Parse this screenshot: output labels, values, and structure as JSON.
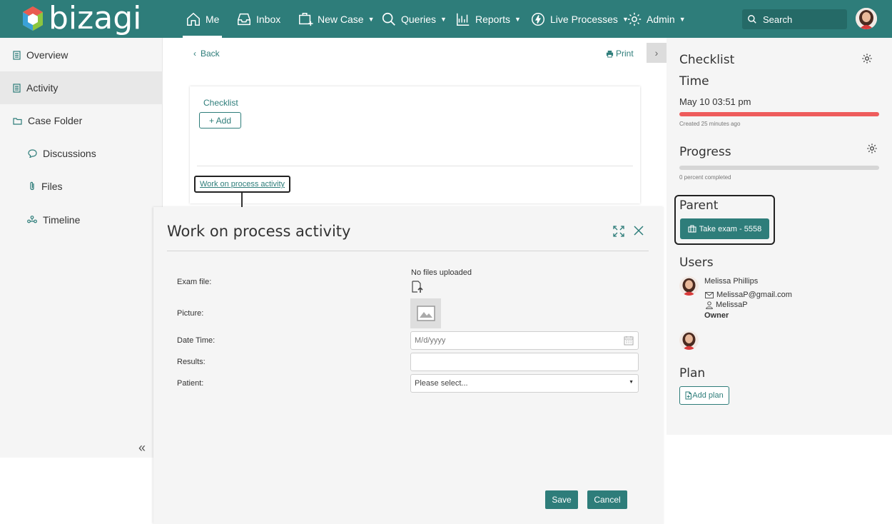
{
  "app": {
    "brand": "bizagi"
  },
  "nav": {
    "items": [
      {
        "label": "Me",
        "icon": "home-icon",
        "active": true
      },
      {
        "label": "Inbox",
        "icon": "inbox-icon"
      },
      {
        "label": "New Case",
        "icon": "new-case-icon",
        "dropdown": true
      },
      {
        "label": "Queries",
        "icon": "search-icon",
        "dropdown": true
      },
      {
        "label": "Reports",
        "icon": "chart-icon",
        "dropdown": true
      },
      {
        "label": "Live Processes",
        "icon": "lightning-icon",
        "dropdown": true
      },
      {
        "label": "Admin",
        "icon": "gear-icon",
        "dropdown": true
      }
    ],
    "search_placeholder": "Search"
  },
  "sidebar": {
    "items": [
      {
        "label": "Overview",
        "icon": "document-icon"
      },
      {
        "label": "Activity",
        "icon": "document-icon",
        "active": true
      },
      {
        "label": "Case Folder",
        "icon": "folder-icon"
      },
      {
        "label": "Discussions",
        "icon": "chat-icon"
      },
      {
        "label": "Files",
        "icon": "paperclip-icon"
      },
      {
        "label": "Timeline",
        "icon": "timeline-icon"
      }
    ]
  },
  "main": {
    "back_label": "Back",
    "print_label": "Print",
    "checklist_title": "Checklist",
    "add_label": "+ Add",
    "activity_link": "Work on process activity"
  },
  "modal": {
    "title": "Work on process activity",
    "fields": {
      "exam_file_label": "Exam file:",
      "no_files": "No files uploaded",
      "picture_label": "Picture:",
      "date_time_label": "Date Time:",
      "date_placeholder": "M/d/yyyy",
      "results_label": "Results:",
      "results_value": "",
      "patient_label": "Patient:",
      "patient_value": "Please select..."
    },
    "save_label": "Save",
    "cancel_label": "Cancel"
  },
  "right_panel": {
    "checklist_heading": "Checklist",
    "time_heading": "Time",
    "time_value": "May 10 03:51 pm",
    "created_text": "Created 25 minutes ago",
    "time_bar_fraction": 1.0,
    "progress_heading": "Progress",
    "progress_text": "0 percent completed",
    "progress_fraction": 0.0,
    "parent_heading": "Parent",
    "parent_button": "Take exam - 5558",
    "users_heading": "Users",
    "user": {
      "name": "Melissa Phillips",
      "email": "MelissaP@gmail.com",
      "username": "MelissaP",
      "role": "Owner"
    },
    "plan_heading": "Plan",
    "add_plan_label": "Add plan"
  },
  "colors": {
    "primary": "#2e7d7a",
    "time_bar": "#ee5c5c",
    "progress_bar": "#d6d6d6",
    "panel_bg": "#f5f5f5"
  }
}
